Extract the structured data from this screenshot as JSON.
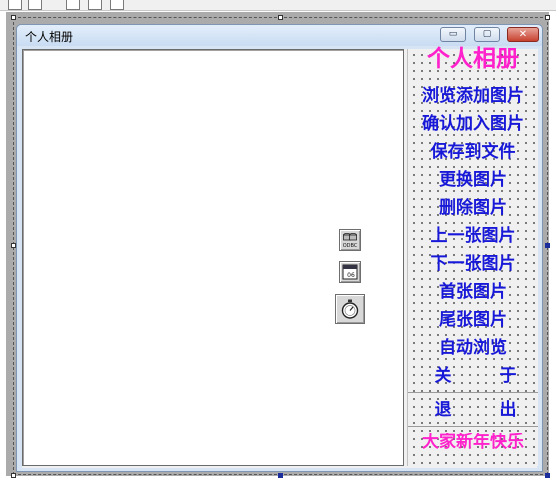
{
  "window": {
    "title": "个人相册",
    "controls": {
      "minimize": "▭",
      "restore": "▢",
      "close": "✕"
    }
  },
  "menu": {
    "heading": "个人相册",
    "items": [
      "浏览添加图片",
      "确认加入图片",
      "保存到文件",
      "更换图片",
      "删除图片",
      "上一张图片",
      "下一张图片",
      "首张图片",
      "尾张图片",
      "自动浏览"
    ],
    "about": [
      "关",
      "于"
    ],
    "exit": [
      "退",
      "出"
    ],
    "footer": "大家新年快乐"
  },
  "designer_controls": [
    {
      "name": "odbc-control-icon",
      "label": "ODBC"
    },
    {
      "name": "calendar-control-icon",
      "label": "06"
    },
    {
      "name": "timer-control-icon",
      "label": "⏱"
    }
  ],
  "colors": {
    "menu_blue": "#1818d8",
    "menu_pink": "#ff22cc",
    "selection_handle": "#1c2e9b"
  }
}
